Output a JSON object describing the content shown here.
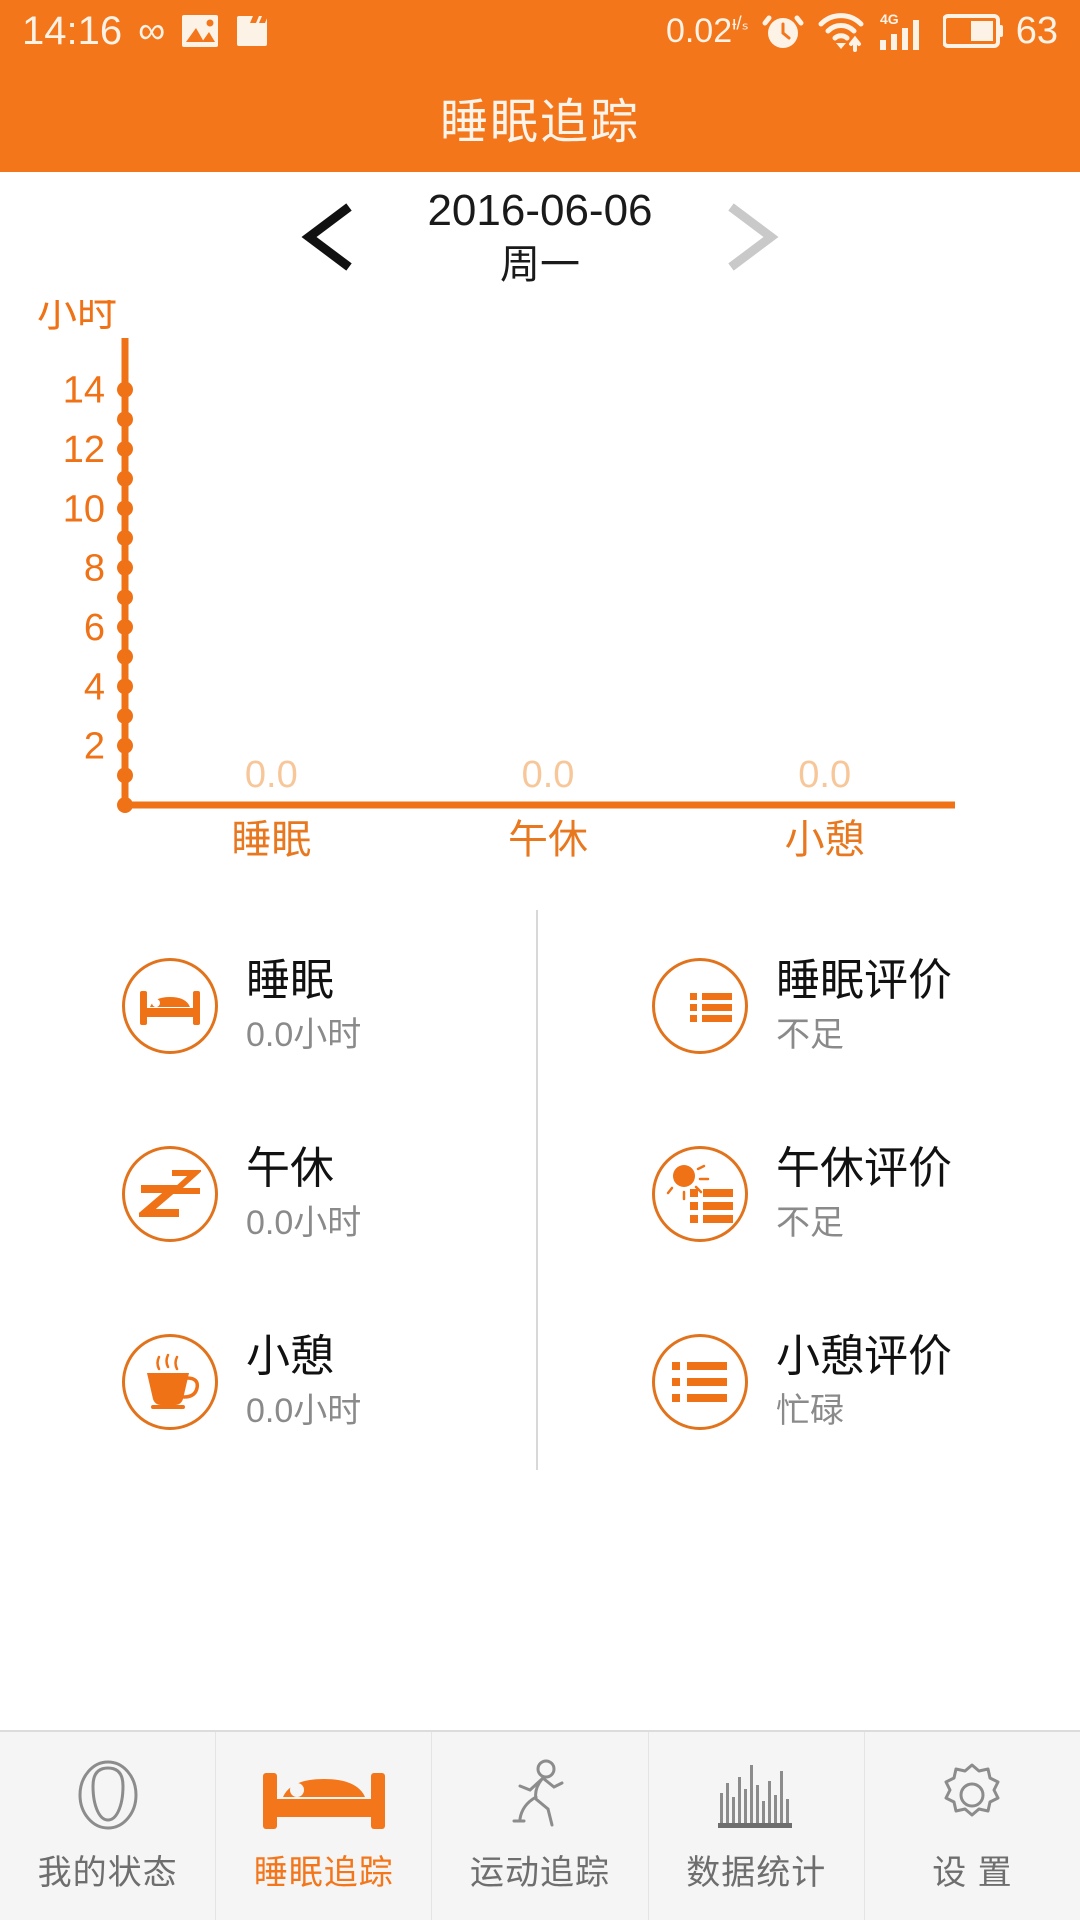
{
  "status_bar": {
    "time": "14:16",
    "infinity_icon": "infinity-icon",
    "gallery_icon": "gallery-icon",
    "clapperboard_icon": "clapperboard-icon",
    "net_speed": "0.02",
    "net_speed_unit_top": "K",
    "net_speed_unit_bottom": "s",
    "alarm_icon": "alarm-clock-icon",
    "wifi_icon": "wifi-icon",
    "network_type": "4G",
    "signal_icon": "signal-bars-icon",
    "battery_icon": "battery-icon",
    "battery_level": "63"
  },
  "app_bar": {
    "title": "睡眠追踪"
  },
  "date_nav": {
    "prev_label": "<",
    "next_label": ">",
    "date": "2016-06-06",
    "weekday": "周一",
    "prev_color": "#111111",
    "next_color": "#c9c9c9"
  },
  "chart_data": {
    "type": "bar",
    "title": "",
    "ylabel": "小时",
    "xlabel": "",
    "categories": [
      "睡眠",
      "午休",
      "小憩"
    ],
    "values": [
      0.0,
      0.0,
      0.0
    ],
    "value_labels": [
      "0.0",
      "0.0",
      "0.0"
    ],
    "ylim": [
      0,
      15
    ],
    "yticks": [
      2,
      4,
      6,
      8,
      10,
      12,
      14
    ],
    "ytick_labels": [
      "2",
      "4",
      "6",
      "8",
      "10",
      "12",
      "14"
    ],
    "minor_tick_step": 1,
    "grid": false,
    "legend": "none",
    "axis_color": "#ef7217",
    "value_label_color": "#f7c79a",
    "category_label_color": "#e8781f"
  },
  "stats": {
    "left": [
      {
        "icon": "bed-icon",
        "title": "睡眠",
        "value": "0.0小时"
      },
      {
        "icon": "zzz-icon",
        "title": "午休",
        "value": "0.0小时"
      },
      {
        "icon": "coffee-cup-icon",
        "title": "小憩",
        "value": "0.0小时"
      }
    ],
    "right": [
      {
        "icon": "moon-list-icon",
        "title": "睡眠评价",
        "value": "不足"
      },
      {
        "icon": "sun-list-icon",
        "title": "午休评价",
        "value": "不足"
      },
      {
        "icon": "list-icon",
        "title": "小憩评价",
        "value": "忙碌"
      }
    ]
  },
  "bottom_nav": {
    "items": [
      {
        "icon": "person-head-icon",
        "label": "我的状态",
        "active": false
      },
      {
        "icon": "bed-icon",
        "label": "睡眠追踪",
        "active": true
      },
      {
        "icon": "running-person-icon",
        "label": "运动追踪",
        "active": false
      },
      {
        "icon": "bar-chart-icon",
        "label": "数据统计",
        "active": false
      },
      {
        "icon": "gear-icon",
        "label": "设 置",
        "active": false
      }
    ]
  },
  "colors": {
    "brand_orange": "#f4761b",
    "chart_orange": "#ef7217",
    "muted_gray": "#8a8a8a",
    "nav_bg": "#f5f5f5"
  }
}
